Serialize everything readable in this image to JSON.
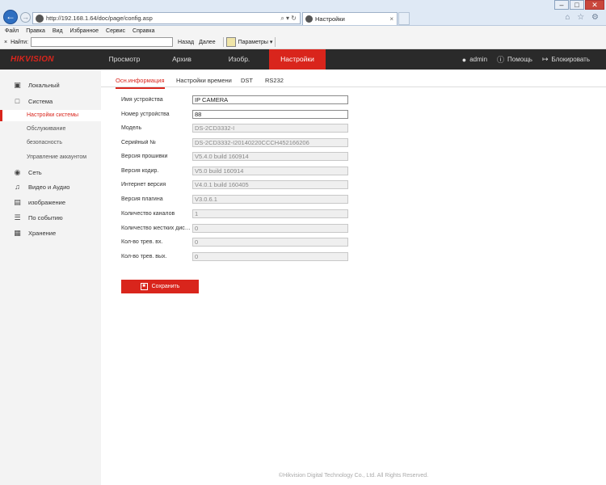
{
  "browser": {
    "url": "http://192.168.1.64/doc/page/config.asp",
    "url_tools": "⌕ ▾ ↻",
    "tab_title": "Настройки",
    "tab_close": "×",
    "window_controls": [
      "–",
      "□",
      "✕"
    ],
    "top_icons": "⌂ ☆ ⚙",
    "menu": [
      "Файл",
      "Правка",
      "Вид",
      "Избранное",
      "Сервис",
      "Справка"
    ],
    "find_close": "×",
    "find_label": "Найти:",
    "find_value": "",
    "find_back": "Назад",
    "find_next": "Далее",
    "params_label": "Параметры ▾"
  },
  "app": {
    "logo": "HIKVISION",
    "nav": [
      "Просмотр",
      "Архив",
      "Изобр.",
      "Настройки"
    ],
    "user": "admin",
    "help": "Помощь",
    "logout": "Блокировать"
  },
  "sidebar": {
    "local": "Локальный",
    "system": "Система",
    "system_sub": [
      "Настройки системы",
      "Обслуживание",
      "безопасность",
      "Управление аккаунтом"
    ],
    "network": "Сеть",
    "video_audio": "Видео и Аудио",
    "image": "изображение",
    "event": "По событию",
    "storage": "Хранение"
  },
  "tabs": [
    "Осн.информация",
    "Настройки времени",
    "DST",
    "RS232"
  ],
  "fields": [
    {
      "label": "Имя устройства",
      "value": "IP CAMERA"
    },
    {
      "label": "Номер устройства",
      "value": "88"
    },
    {
      "label": "Модель",
      "value": "DS-2CD3332-I"
    },
    {
      "label": "Серийный №",
      "value": "DS-2CD3332-I20140220CCCH452166206"
    },
    {
      "label": "Версия прошивки",
      "value": "V5.4.0 build 160914"
    },
    {
      "label": "Версия кодир.",
      "value": "V5.0 build 160914"
    },
    {
      "label": "Интернет версия",
      "value": "V4.0.1 build 160405"
    },
    {
      "label": "Версия плагина",
      "value": "V3.0.6.1"
    },
    {
      "label": "Количество каналов",
      "value": "1"
    },
    {
      "label": "Количество жестких дисков",
      "value": "0"
    },
    {
      "label": "Кол-во трев. вх.",
      "value": "0"
    },
    {
      "label": "Кол-во трев. вых.",
      "value": "0"
    }
  ],
  "save_label": "Сохранить",
  "footer": "©Hikvision Digital Technology Co., Ltd. All Rights Reserved."
}
